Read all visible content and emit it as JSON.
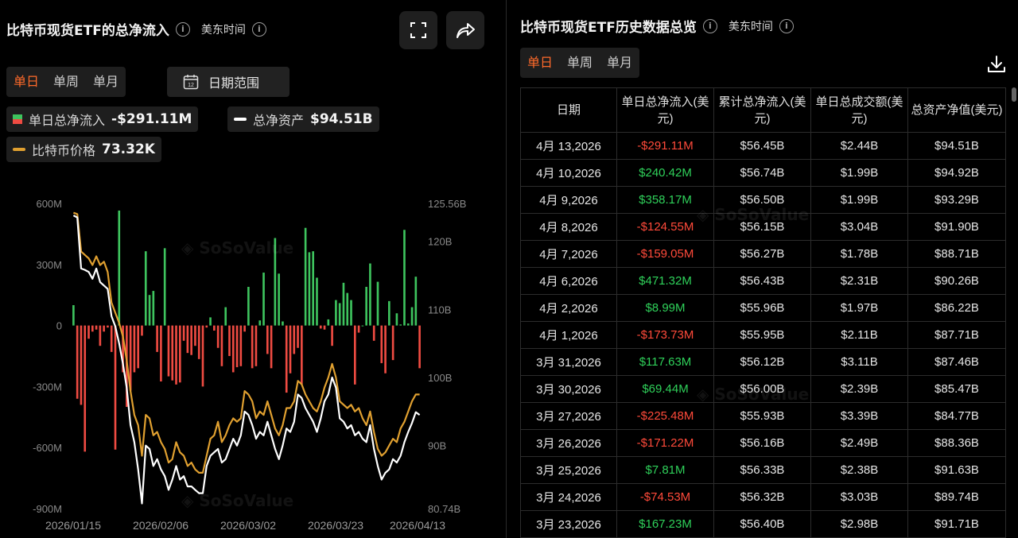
{
  "left_panel": {
    "title": "比特币现货ETF的总净流入",
    "timezone": "美东时间",
    "period_tabs": [
      "单日",
      "单周",
      "单月"
    ],
    "date_range_label": "日期范围",
    "date_range_icon_text": "12",
    "legend": {
      "net_inflow_label": "单日总净流入",
      "net_inflow_value": "-$291.11M",
      "net_assets_label": "总净资产",
      "net_assets_value": "$94.51B",
      "btc_price_label": "比特币价格",
      "btc_price_value": "73.32K"
    },
    "watermark": "SoSoValue"
  },
  "chart_data": {
    "type": "bar",
    "x_tick_labels": [
      "2026/01/15",
      "2026/02/06",
      "2026/03/02",
      "2026/03/23",
      "2026/04/13"
    ],
    "y_left_ticks": [
      "600M",
      "300M",
      "0",
      "-300M",
      "-600M",
      "-900M"
    ],
    "y_left_range_millions": [
      -900,
      600
    ],
    "y_right_ticks": [
      "125.56B",
      "120B",
      "110B",
      "100B",
      "90B",
      "80.74B"
    ],
    "y_right_range_billions": [
      80.74,
      125.56
    ],
    "colors": {
      "positive": "#3ec45e",
      "negative": "#ef4b42",
      "net_assets": "#ffffff",
      "btc_price": "#e0a030"
    },
    "series": [
      {
        "name": "单日总净流入",
        "values": [
          100,
          -360,
          -390,
          -620,
          -65,
          -30,
          -20,
          -100,
          -30,
          -10,
          -130,
          -610,
          565,
          -230,
          -400,
          -320,
          -230,
          -210,
          -50,
          365,
          150,
          170,
          -130,
          -275,
          380,
          -250,
          -270,
          -290,
          -280,
          -75,
          -135,
          -145,
          -100,
          -165,
          -300,
          -10,
          40,
          -25,
          -110,
          -200,
          90,
          -150,
          -230,
          -205,
          -200,
          -30,
          190,
          -210,
          -200,
          25,
          260,
          -140,
          -210,
          430,
          255,
          20,
          -330,
          -235,
          -140,
          -110,
          -290,
          480,
          360,
          365,
          235,
          -15,
          -20,
          30,
          -100,
          125,
          110,
          210,
          160,
          125,
          -290,
          -35,
          0,
          190,
          305,
          -75,
          215,
          -185,
          -235,
          120,
          -170,
          60,
          5,
          470,
          10,
          90,
          240,
          -210
        ]
      },
      {
        "name": "总净资产",
        "values": [
          123.8,
          123.5,
          116.0,
          115.8,
          115.5,
          114.5,
          116.0,
          114.0,
          113.5,
          113.0,
          109.0,
          107.5,
          105.0,
          102.0,
          98.5,
          93.0,
          90.5,
          86.5,
          81.5,
          90.0,
          89.5,
          87.0,
          88.0,
          86.5,
          85.5,
          83.5,
          85.0,
          87.0,
          85.0,
          85.5,
          84.0,
          84.0,
          83.5,
          83.0,
          83.0,
          87.0,
          88.5,
          89.0,
          89.5,
          87.5,
          88.0,
          89.5,
          91.0,
          90.0,
          91.5,
          95.0,
          94.5,
          93.0,
          91.0,
          92.0,
          91.5,
          93.5,
          91.5,
          89.5,
          88.0,
          90.0,
          92.5,
          92.0,
          93.5,
          97.5,
          97.0,
          95.5,
          94.5,
          93.5,
          92.0,
          94.0,
          96.5,
          97.5,
          100.0,
          98.5,
          94.0,
          93.5,
          92.5,
          93.0,
          91.5,
          92.0,
          91.0,
          90.5,
          93.0,
          89.5,
          87.0,
          85.0,
          86.0,
          86.5,
          88.0,
          87.5,
          88.5,
          90.5,
          92.0,
          93.3,
          94.9,
          94.5
        ]
      },
      {
        "name": "比特币价格",
        "values": [
          124.2,
          124.0,
          118.5,
          118.0,
          117.5,
          116.5,
          117.8,
          116.5,
          117.0,
          115.5,
          111.0,
          109.5,
          108.0,
          106.0,
          102.5,
          98.0,
          94.5,
          93.0,
          88.5,
          94.5,
          94.0,
          91.5,
          92.0,
          90.5,
          89.5,
          87.5,
          88.0,
          90.5,
          89.0,
          88.5,
          87.0,
          87.5,
          86.5,
          86.0,
          86.0,
          88.5,
          91.0,
          91.5,
          93.5,
          90.5,
          91.5,
          93.0,
          94.0,
          93.5,
          94.0,
          98.0,
          97.5,
          96.5,
          94.0,
          95.0,
          94.5,
          96.5,
          94.5,
          92.5,
          91.5,
          93.0,
          95.5,
          95.5,
          96.5,
          99.5,
          99.0,
          97.5,
          96.5,
          95.5,
          95.0,
          96.5,
          98.5,
          100.0,
          102.0,
          100.0,
          96.5,
          96.0,
          95.5,
          96.0,
          95.0,
          95.5,
          94.0,
          93.0,
          95.0,
          92.0,
          89.5,
          88.5,
          89.0,
          90.0,
          91.0,
          90.5,
          92.5,
          93.5,
          95.0,
          96.5,
          97.5,
          97.5
        ]
      }
    ],
    "grid": false,
    "legend_position": "top"
  },
  "right_panel": {
    "title": "比特币现货ETF历史数据总览",
    "timezone": "美东时间",
    "period_tabs": [
      "单日",
      "单周",
      "单月"
    ],
    "columns": [
      "日期",
      "单日总净流入(美元)",
      "累计总净流入(美元)",
      "单日总成交额(美元)",
      "总资产净值(美元)"
    ],
    "rows": [
      {
        "date": "4月 13,2026",
        "net": "-$291.11M",
        "cum": "$56.45B",
        "vol": "$2.44B",
        "nav": "$94.51B"
      },
      {
        "date": "4月 10,2026",
        "net": "$240.42M",
        "cum": "$56.74B",
        "vol": "$1.99B",
        "nav": "$94.92B"
      },
      {
        "date": "4月 9,2026",
        "net": "$358.17M",
        "cum": "$56.50B",
        "vol": "$1.99B",
        "nav": "$93.29B"
      },
      {
        "date": "4月 8,2026",
        "net": "-$124.55M",
        "cum": "$56.15B",
        "vol": "$3.04B",
        "nav": "$91.90B"
      },
      {
        "date": "4月 7,2026",
        "net": "-$159.05M",
        "cum": "$56.27B",
        "vol": "$1.78B",
        "nav": "$88.71B"
      },
      {
        "date": "4月 6,2026",
        "net": "$471.32M",
        "cum": "$56.43B",
        "vol": "$2.31B",
        "nav": "$90.26B"
      },
      {
        "date": "4月 2,2026",
        "net": "$8.99M",
        "cum": "$55.96B",
        "vol": "$1.97B",
        "nav": "$86.22B"
      },
      {
        "date": "4月 1,2026",
        "net": "-$173.73M",
        "cum": "$55.95B",
        "vol": "$2.11B",
        "nav": "$87.71B"
      },
      {
        "date": "3月 31,2026",
        "net": "$117.63M",
        "cum": "$56.12B",
        "vol": "$3.11B",
        "nav": "$87.46B"
      },
      {
        "date": "3月 30,2026",
        "net": "$69.44M",
        "cum": "$56.00B",
        "vol": "$2.39B",
        "nav": "$85.47B"
      },
      {
        "date": "3月 27,2026",
        "net": "-$225.48M",
        "cum": "$55.93B",
        "vol": "$3.39B",
        "nav": "$84.77B"
      },
      {
        "date": "3月 26,2026",
        "net": "-$171.22M",
        "cum": "$56.16B",
        "vol": "$2.49B",
        "nav": "$88.36B"
      },
      {
        "date": "3月 25,2026",
        "net": "$7.81M",
        "cum": "$56.33B",
        "vol": "$2.38B",
        "nav": "$91.63B"
      },
      {
        "date": "3月 24,2026",
        "net": "-$74.53M",
        "cum": "$56.32B",
        "vol": "$3.03B",
        "nav": "$89.74B"
      },
      {
        "date": "3月 23,2026",
        "net": "$167.23M",
        "cum": "$56.40B",
        "vol": "$2.98B",
        "nav": "$91.71B"
      }
    ],
    "watermark": "SoSoValue"
  }
}
